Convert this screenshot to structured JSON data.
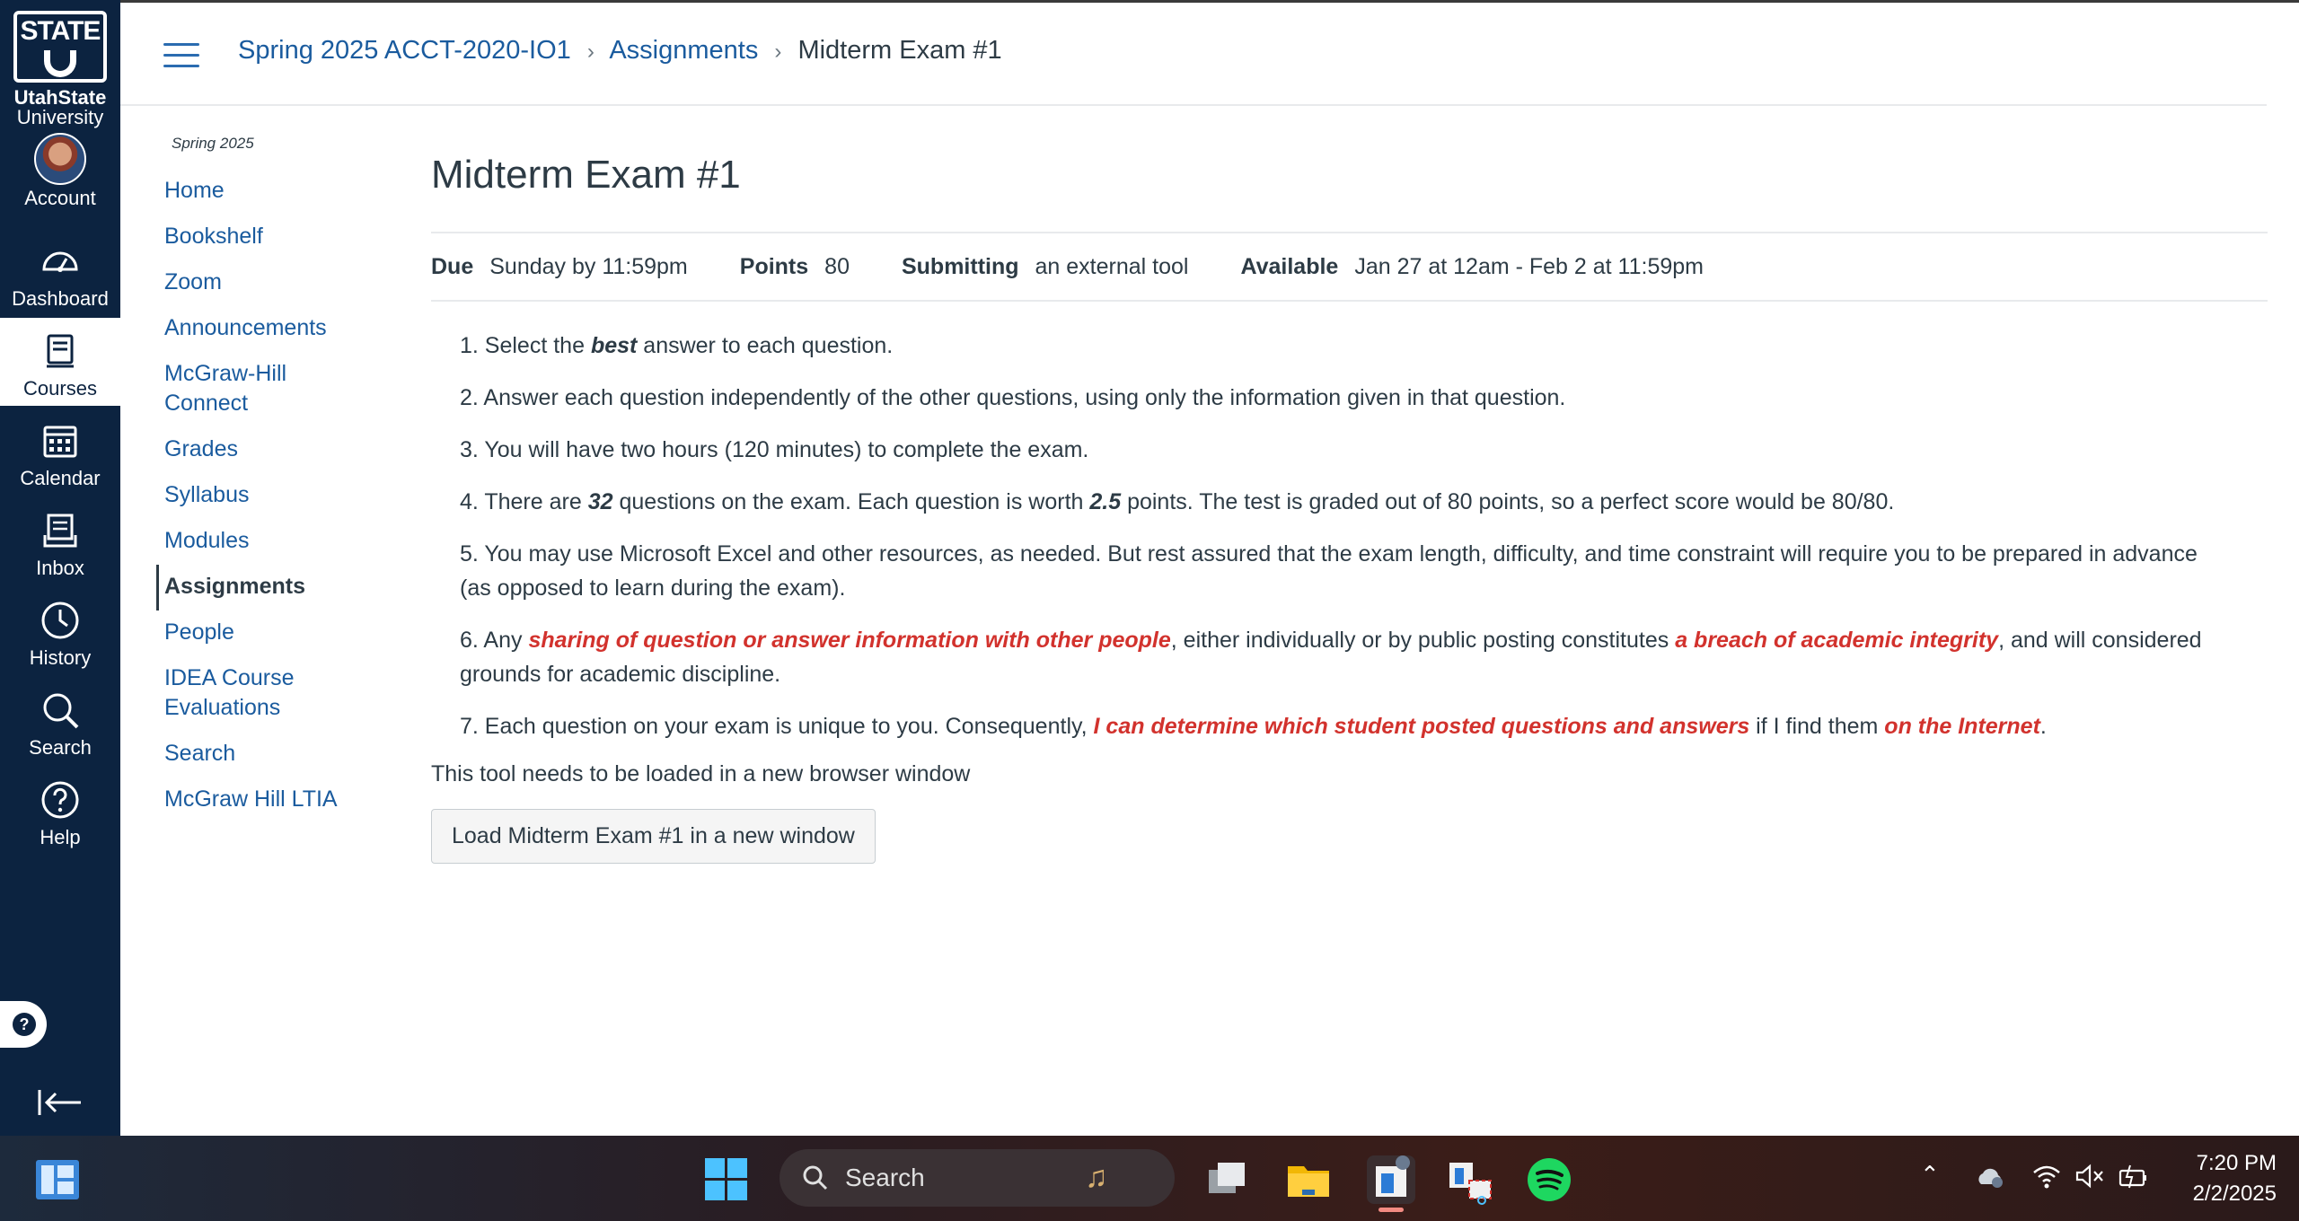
{
  "global_nav": {
    "logo_word": "STATE",
    "logo_name_line1": "UtahState",
    "logo_name_line2": "University",
    "items": [
      {
        "label": "Account",
        "icon": "avatar"
      },
      {
        "label": "Dashboard",
        "icon": "dashboard-icon"
      },
      {
        "label": "Courses",
        "icon": "courses-icon"
      },
      {
        "label": "Calendar",
        "icon": "calendar-icon"
      },
      {
        "label": "Inbox",
        "icon": "inbox-icon"
      },
      {
        "label": "History",
        "icon": "history-icon"
      },
      {
        "label": "Search",
        "icon": "search-icon"
      },
      {
        "label": "Help",
        "icon": "help-icon"
      }
    ],
    "active": "Courses"
  },
  "breadcrumb": {
    "course": "Spring 2025 ACCT-2020-IO1",
    "section": "Assignments",
    "current": "Midterm Exam #1",
    "separator": "›"
  },
  "course_nav": {
    "term": "Spring 2025",
    "items": [
      "Home",
      "Bookshelf",
      "Zoom",
      "Announcements",
      "McGraw-Hill Connect",
      "Grades",
      "Syllabus",
      "Modules",
      "Assignments",
      "People",
      "IDEA Course Evaluations",
      "Search",
      "McGraw Hill LTIA"
    ],
    "active": "Assignments"
  },
  "assignment": {
    "title": "Midterm Exam #1",
    "details": {
      "due_label": "Due",
      "due_value": "Sunday by 11:59pm",
      "points_label": "Points",
      "points_value": "80",
      "submitting_label": "Submitting",
      "submitting_value": "an external tool",
      "available_label": "Available",
      "available_value": "Jan 27 at 12am - Feb 2 at 11:59pm"
    },
    "rules": {
      "r1": {
        "a": "1. Select the ",
        "b": "best",
        "c": " answer to each question."
      },
      "r2": "2. Answer each question independently of the other questions, using only the information given in that question.",
      "r3": "3. You will have two hours (120 minutes) to complete the exam.",
      "r4": {
        "a": "4. There are ",
        "b": "32",
        "c": " questions on the exam. Each question is worth ",
        "d": "2.5",
        "e": " points. The test is graded out of 80 points, so a perfect score would be 80/80."
      },
      "r5": "5. You may use Microsoft Excel and other resources, as needed. But rest assured that the exam length, difficulty, and time constraint will require you to be prepared in advance (as opposed to learn during the exam).",
      "r6": {
        "a": "6. Any ",
        "b": "sharing of question or answer information with other people",
        "c": ", either individually or by public posting constitutes ",
        "d": "a breach of academic integrity",
        "e": ", and will considered grounds for academic discipline."
      },
      "r7": {
        "a": "7. Each question on your exam is unique to you. Consequently, ",
        "b": "I can determine which student posted questions and answers",
        "c": " if I find them ",
        "d": "on the Internet",
        "e": "."
      }
    },
    "tool_message": "This tool needs to be loaded in a new browser window",
    "load_button": "Load Midterm Exam #1 in a new window"
  },
  "taskbar": {
    "search_label": "Search",
    "time": "7:20 PM",
    "date": "2/2/2025",
    "apps": [
      "widgets-icon",
      "start-icon",
      "task-view-icon",
      "file-explorer-icon",
      "store-icon",
      "snipping-tool-icon",
      "spotify-icon"
    ]
  },
  "colors": {
    "nav_bg": "#0c2340",
    "link": "#1a5b9e",
    "warning_red": "#d2322d",
    "text": "#2d3b45"
  }
}
